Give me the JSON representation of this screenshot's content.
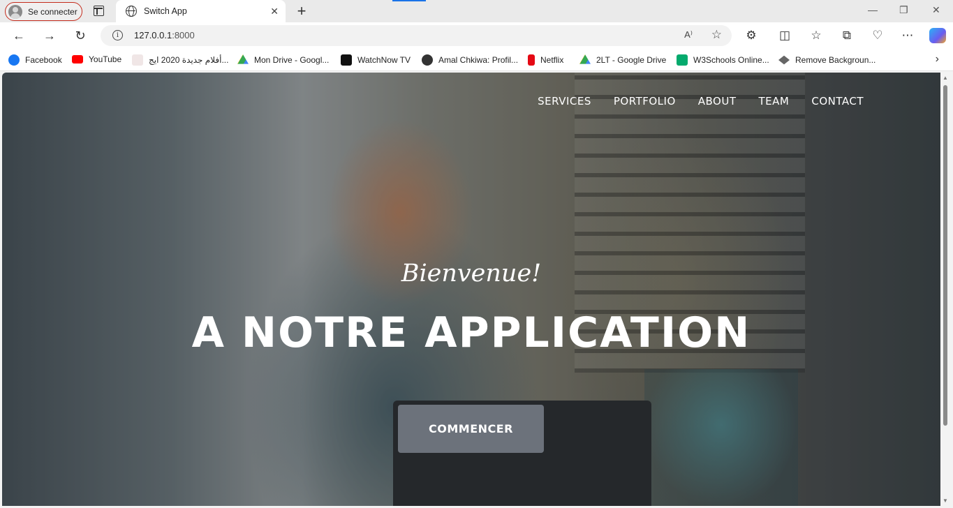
{
  "browser": {
    "profile_label": "Se connecter",
    "tab_title": "Switch App",
    "tab_close": "✕",
    "new_tab": "+",
    "window_controls": {
      "minimize": "—",
      "restore": "❐",
      "close": "✕"
    },
    "url_host": "127.0.0.1",
    "url_port": ":8000",
    "read_aloud": "A⁾",
    "nav": {
      "back": "←",
      "forward": "→",
      "refresh": "↻"
    },
    "tools": [
      "⚙",
      "◫",
      "☆",
      "⧉",
      "♡",
      "⋯"
    ],
    "bookmarks": [
      {
        "label": "Facebook",
        "color": "#1877f2"
      },
      {
        "label": "YouTube",
        "color": "#ff0000"
      },
      {
        "label": "أفلام جديدة 2020 ايج...",
        "color": "#d44"
      },
      {
        "label": "Mon Drive - Googl...",
        "color": "#34a853"
      },
      {
        "label": "WatchNow TV",
        "color": "#111111"
      },
      {
        "label": "Amal Chkiwa: Profil...",
        "color": "#333333"
      },
      {
        "label": "Netflix",
        "color": "#e50914"
      },
      {
        "label": "2LT - Google Drive",
        "color": "#fbbc04"
      },
      {
        "label": "W3Schools Online...",
        "color": "#04aa6d"
      },
      {
        "label": "Remove Backgroun...",
        "color": "#666666"
      }
    ],
    "bookmarks_more": "›"
  },
  "site": {
    "nav": [
      "SERVICES",
      "PORTFOLIO",
      "ABOUT",
      "TEAM",
      "CONTACT"
    ],
    "hero_subtitle": "Bienvenue!",
    "hero_title": "A NOTRE APPLICATION",
    "hero_button": "COMMENCER"
  }
}
